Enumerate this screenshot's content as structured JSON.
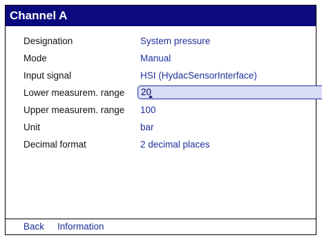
{
  "window": {
    "title": "Channel A"
  },
  "fields": [
    {
      "label": "Designation",
      "value": "System pressure"
    },
    {
      "label": "Mode",
      "value": "Manual"
    },
    {
      "label": "Input signal",
      "value": "HSI (HydacSensorInterface)"
    },
    {
      "label": "Lower measurem. range",
      "value": "20"
    },
    {
      "label": "Upper measurem. range",
      "value": "100"
    },
    {
      "label": "Unit",
      "value": "bar"
    },
    {
      "label": "Decimal format",
      "value": "2 decimal places"
    }
  ],
  "footer": {
    "back_label": "Back",
    "information_label": "Information"
  },
  "colors": {
    "title_bg": "#0a0a7e",
    "value_text": "#1c2f9a",
    "edit_bg": "#d9ddf6"
  }
}
